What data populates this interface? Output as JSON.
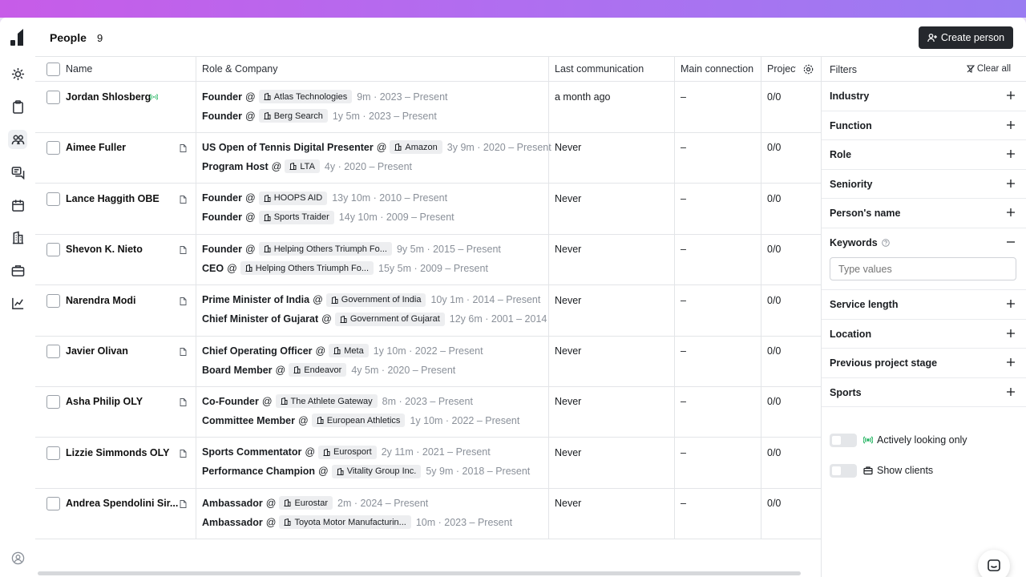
{
  "header": {
    "title": "People",
    "count": "9",
    "create_label": "Create person"
  },
  "columns": {
    "name": "Name",
    "role": "Role & Company",
    "last": "Last communication",
    "main": "Main connection",
    "projects": "Projects"
  },
  "rows": [
    {
      "name": "Jordan Shlosberg",
      "roles": [
        {
          "title": "Founder",
          "company": "Atlas Technologies",
          "duration": "9m · 2023 – Present"
        },
        {
          "title": "Founder",
          "company": "Berg Search",
          "duration": "1y 5m · 2023 – Present"
        }
      ],
      "last": "a month ago",
      "main": "–",
      "projects": "0/0"
    },
    {
      "name": "Aimee Fuller",
      "roles": [
        {
          "title": "US Open of Tennis Digital Presenter",
          "company": "Amazon",
          "duration": "3y 9m · 2020 – Present"
        },
        {
          "title": "Program Host",
          "company": "LTA",
          "duration": "4y · 2020 – Present"
        }
      ],
      "last": "Never",
      "main": "–",
      "projects": "0/0"
    },
    {
      "name": "Lance Haggith OBE",
      "roles": [
        {
          "title": "Founder",
          "company": "HOOPS AID",
          "duration": "13y 10m · 2010 – Present"
        },
        {
          "title": "Founder",
          "company": "Sports Traider",
          "duration": "14y 10m · 2009 – Present"
        }
      ],
      "last": "Never",
      "main": "–",
      "projects": "0/0"
    },
    {
      "name": "Shevon K. Nieto",
      "roles": [
        {
          "title": "Founder",
          "company": "Helping Others Triumph Fo...",
          "duration": "9y 5m · 2015 – Present"
        },
        {
          "title": "CEO",
          "company": "Helping Others Triumph Fo...",
          "duration": "15y 5m · 2009 – Present"
        }
      ],
      "last": "Never",
      "main": "–",
      "projects": "0/0"
    },
    {
      "name": "Narendra Modi",
      "roles": [
        {
          "title": "Prime Minister of India",
          "company": "Government of India",
          "duration": "10y 1m · 2014 – Present"
        },
        {
          "title": "Chief Minister of Gujarat",
          "company": "Government of Gujarat",
          "duration": "12y 6m · 2001 – 2014"
        }
      ],
      "last": "Never",
      "main": "–",
      "projects": "0/0"
    },
    {
      "name": "Javier Olivan",
      "roles": [
        {
          "title": "Chief Operating Officer",
          "company": "Meta",
          "duration": "1y 10m · 2022 – Present"
        },
        {
          "title": "Board Member",
          "company": "Endeavor",
          "duration": "4y 5m · 2020 – Present"
        }
      ],
      "last": "Never",
      "main": "–",
      "projects": "0/0"
    },
    {
      "name": "Asha Philip OLY",
      "roles": [
        {
          "title": "Co-Founder",
          "company": "The Athlete Gateway",
          "duration": "8m · 2023 – Present"
        },
        {
          "title": "Committee Member",
          "company": "European Athletics",
          "duration": "1y 10m · 2022 – Present"
        }
      ],
      "last": "Never",
      "main": "–",
      "projects": "0/0"
    },
    {
      "name": "Lizzie Simmonds OLY",
      "roles": [
        {
          "title": "Sports Commentator",
          "company": "Eurosport",
          "duration": "2y 11m · 2021 – Present"
        },
        {
          "title": "Performance Champion",
          "company": "Vitality Group Inc.",
          "duration": "5y 9m · 2018 – Present"
        }
      ],
      "last": "Never",
      "main": "–",
      "projects": "0/0"
    },
    {
      "name": "Andrea Spendolini Sir...",
      "roles": [
        {
          "title": "Ambassador",
          "company": "Eurostar",
          "duration": "2m · 2024 – Present"
        },
        {
          "title": "Ambassador",
          "company": "Toyota Motor Manufacturin...",
          "duration": "10m · 2023 – Present"
        }
      ],
      "last": "Never",
      "main": "–",
      "projects": "0/0"
    }
  ],
  "filters": {
    "title": "Filters",
    "clear_label": "Clear all",
    "sections": [
      "Industry",
      "Function",
      "Role",
      "Seniority",
      "Person's name",
      "Keywords",
      "Service length",
      "Location",
      "Previous project stage",
      "Sports"
    ],
    "keywords_placeholder": "Type values",
    "toggle_active": "Actively looking only",
    "toggle_clients": "Show clients"
  },
  "colors": {
    "accent_green": "#2fb86a",
    "button_dark": "#25282d",
    "gradient_top": "#c75ce8"
  }
}
